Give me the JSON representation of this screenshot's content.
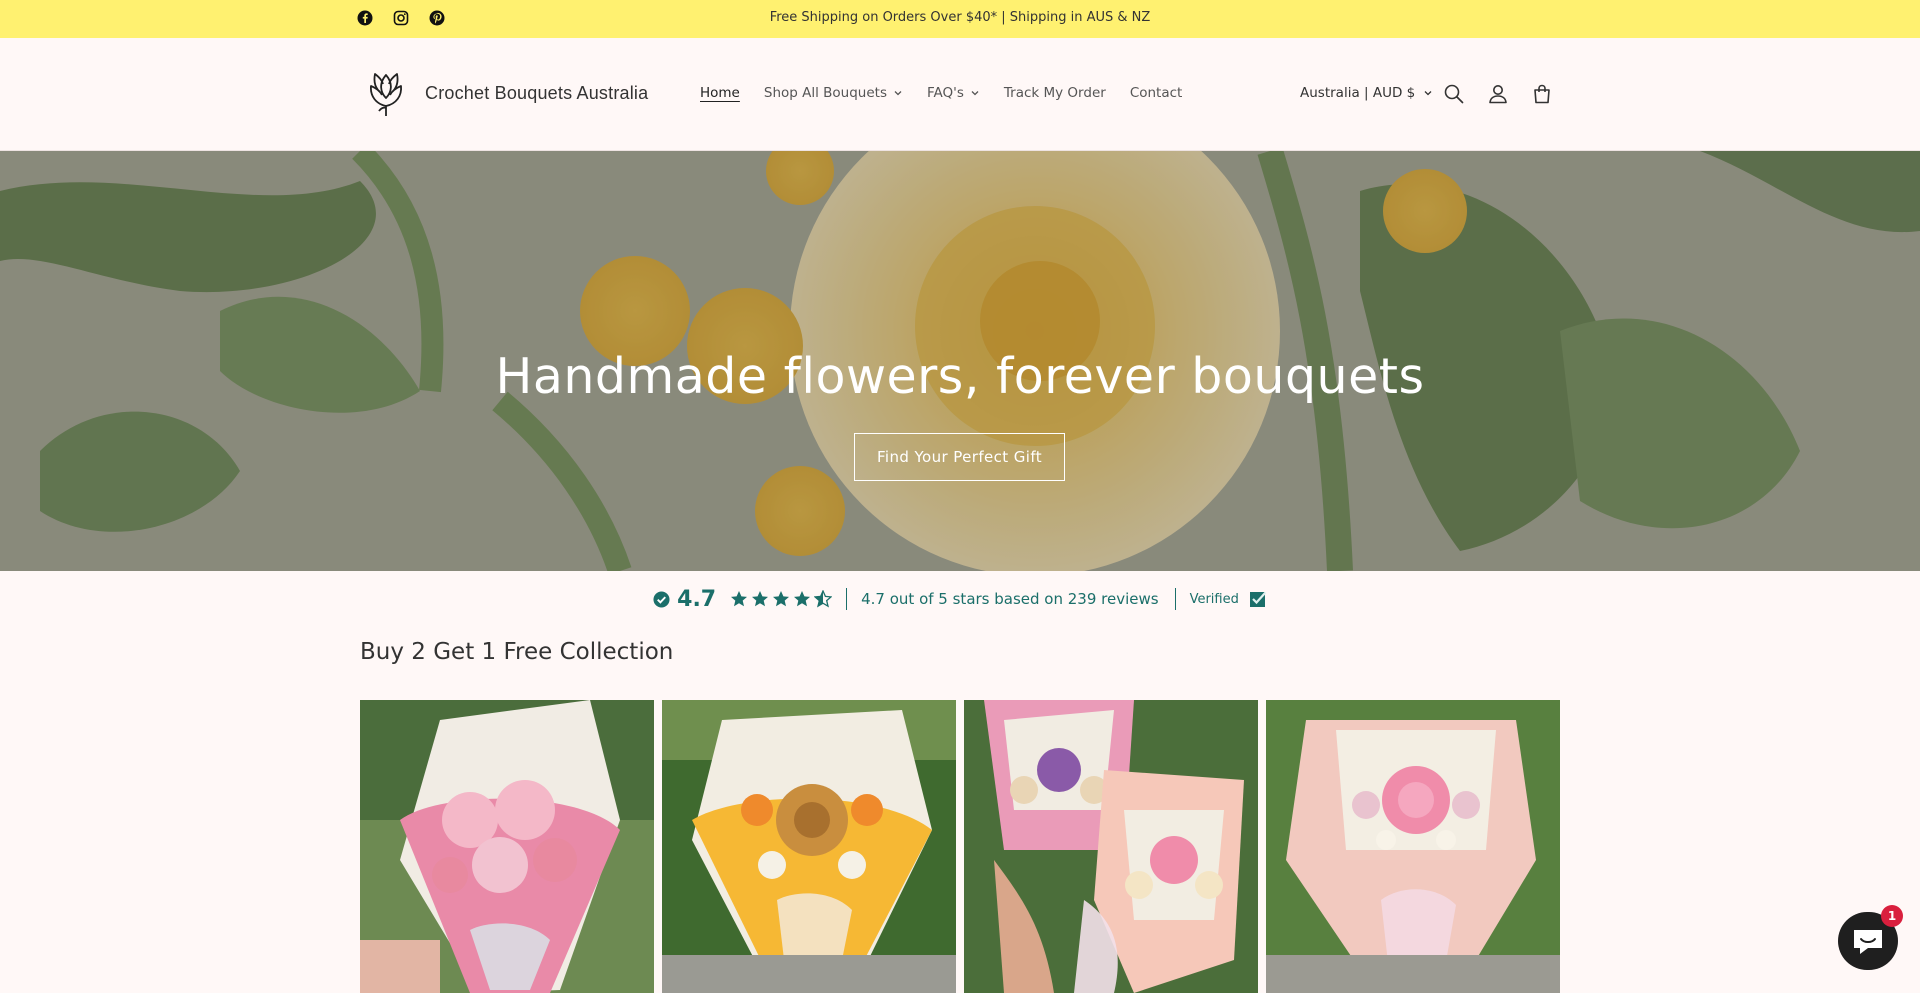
{
  "announcement": {
    "text": "Free Shipping on Orders Over $40* | Shipping in AUS & NZ",
    "background": "#fff170",
    "social_icons": [
      "facebook-icon",
      "instagram-icon",
      "pinterest-icon"
    ]
  },
  "header": {
    "brand": "Crochet Bouquets Australia",
    "nav": [
      {
        "label": "Home",
        "active": true,
        "has_dropdown": false
      },
      {
        "label": "Shop All Bouquets",
        "active": false,
        "has_dropdown": true
      },
      {
        "label": "FAQ's",
        "active": false,
        "has_dropdown": true
      },
      {
        "label": "Track My Order",
        "active": false,
        "has_dropdown": false
      },
      {
        "label": "Contact",
        "active": false,
        "has_dropdown": false
      }
    ],
    "locale": "Australia | AUD $",
    "icons": [
      "search-icon",
      "account-icon",
      "cart-icon"
    ]
  },
  "hero": {
    "title": "Handmade flowers, forever bouquets",
    "button": "Find Your Perfect Gift"
  },
  "reviews": {
    "score": "4.7",
    "rating_value": 4.7,
    "rating_max": 5,
    "summary": "4.7 out of 5 stars based on 239 reviews",
    "verified": "Verified",
    "accent": "#1b6f6a"
  },
  "collection": {
    "title": "Buy 2 Get 1 Free Collection",
    "products": [
      {
        "name": "pink-rose-bouquet",
        "wrap": "#e98aa8",
        "flower": "#f4b8c8"
      },
      {
        "name": "sunflower-bouquet",
        "wrap": "#f6b834",
        "flower": "#c98e3e"
      },
      {
        "name": "purple-rose-bouquet",
        "wrap": "#ea9bb8",
        "flower": "#8a5aa8"
      },
      {
        "name": "peach-rose-bouquet",
        "wrap": "#f2c9bf",
        "flower": "#f08caa"
      }
    ]
  },
  "chat": {
    "badge": "1"
  }
}
